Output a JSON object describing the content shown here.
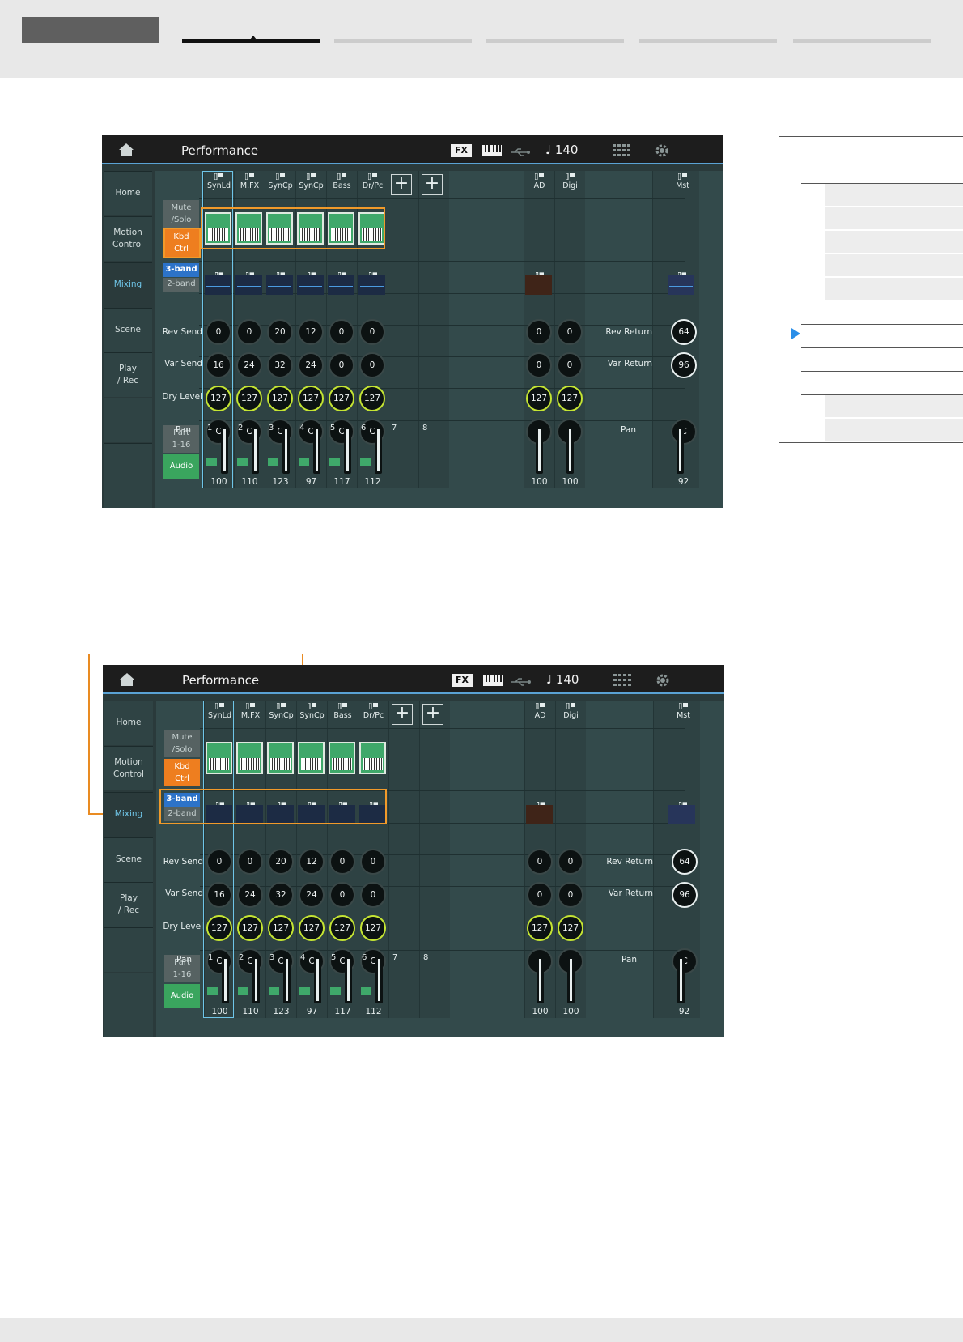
{
  "screen": {
    "title": "Performance",
    "fx_badge": "FX",
    "tempo": "♩ 140",
    "tabs": [
      "Home",
      "Motion\nControl",
      "Mixing",
      "Scene",
      "Play\n/ Rec"
    ],
    "active_tab": "Mixing",
    "parts": [
      {
        "num": "1",
        "name": "SynLd",
        "rev": "0",
        "var": "16",
        "dry": "127",
        "pan": "C",
        "vol": "100"
      },
      {
        "num": "2",
        "name": "M.FX",
        "rev": "0",
        "var": "24",
        "dry": "127",
        "pan": "C",
        "vol": "110"
      },
      {
        "num": "3",
        "name": "SynCp",
        "rev": "20",
        "var": "32",
        "dry": "127",
        "pan": "C",
        "vol": "123"
      },
      {
        "num": "4",
        "name": "SynCp",
        "rev": "12",
        "var": "24",
        "dry": "127",
        "pan": "C",
        "vol": "97"
      },
      {
        "num": "5",
        "name": "Bass",
        "rev": "0",
        "var": "0",
        "dry": "127",
        "pan": "C",
        "vol": "117"
      },
      {
        "num": "6",
        "name": "Dr/Pc",
        "rev": "0",
        "var": "0",
        "dry": "127",
        "pan": "C",
        "vol": "112"
      }
    ],
    "empty_parts": [
      "7",
      "8"
    ],
    "audio_parts": [
      {
        "name": "AD",
        "rev": "0",
        "var": "0",
        "dry": "127",
        "pan": "C",
        "vol": "100"
      },
      {
        "name": "Digi",
        "rev": "0",
        "var": "0",
        "dry": "127",
        "pan": "C",
        "vol": "100"
      }
    ],
    "master": {
      "name": "Mst",
      "rev_return": "64",
      "var_return": "96",
      "pan": "C",
      "vol": "92"
    },
    "row_labels": {
      "rev_send": "Rev Send",
      "var_send": "Var Send",
      "dry_level": "Dry Level",
      "pan": "Pan"
    },
    "right_labels": {
      "rev_return": "Rev Return",
      "var_return": "Var Return",
      "pan": "Pan"
    },
    "buttons": {
      "mute_solo": "Mute\n/Solo",
      "kbd_ctrl": "Kbd\nCtrl",
      "band3": "3-band",
      "band2": "2-band",
      "part_range": "Part\n1-16",
      "audio": "Audio"
    },
    "plus_label": "+"
  },
  "colors": {
    "accent_orange": "#f19a2a",
    "kbd_green": "#3fa86a",
    "knob_lime": "#c5e533",
    "active_tab_blue": "#6fc5e8",
    "eq_blue": "#2c73c9"
  }
}
